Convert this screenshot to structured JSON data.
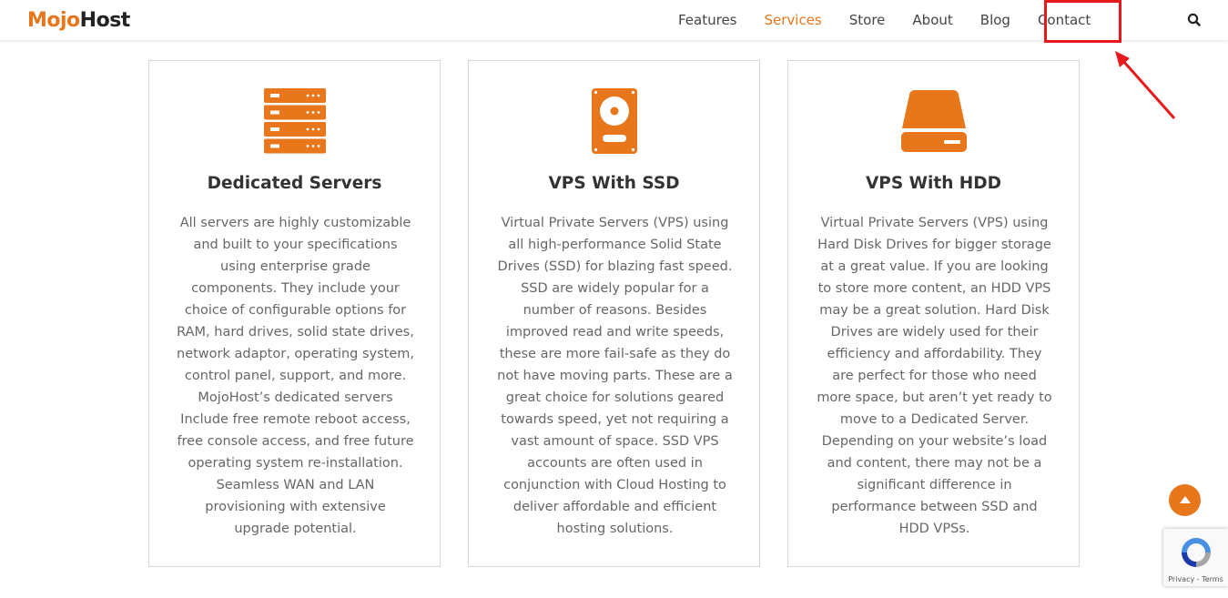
{
  "brand": {
    "logo_part1": "Mojo",
    "logo_part2": "Host",
    "accent": "#e8761a"
  },
  "nav": {
    "items": [
      {
        "label": "Features",
        "active": false
      },
      {
        "label": "Services",
        "active": true
      },
      {
        "label": "Store",
        "active": false
      },
      {
        "label": "About",
        "active": false
      },
      {
        "label": "Blog",
        "active": false
      },
      {
        "label": "Contact",
        "active": false
      }
    ],
    "search_icon": "search-icon"
  },
  "annotation": {
    "highlight_color": "#e8191b",
    "target": "Contact"
  },
  "cards": [
    {
      "icon": "server-rack-icon",
      "title": "Dedicated Servers",
      "text": "All servers are highly customizable and built to your specifications using enterprise grade components. They include your choice of configurable options for RAM, hard drives, solid state drives, network adaptor, operating system, control panel, support, and more. MojoHost’s dedicated servers Include free remote reboot access, free console access, and free future operating system re-installation. Seamless WAN and LAN provisioning with extensive upgrade potential."
    },
    {
      "icon": "hard-disk-icon",
      "title": "VPS With SSD",
      "text": "Virtual Private Servers (VPS) using all high-performance Solid State Drives (SSD) for blazing fast speed. SSD are widely popular for a number of reasons. Besides improved read and write speeds, these are more fail-safe as they do not have moving parts. These are a great choice for solutions geared towards speed, yet not requiring a vast amount of space. SSD VPS accounts are often used in conjunction with Cloud Hosting to deliver affordable and efficient hosting solutions."
    },
    {
      "icon": "hdd-drive-icon",
      "title": "VPS With HDD",
      "text": "Virtual Private Servers (VPS) using Hard Disk Drives for bigger storage at a great value. If you are looking to store more content, an HDD VPS may be a great solution. Hard Disk Drives are widely used for their efficiency and affordability. They are perfect for those who need more space, but aren’t yet ready to move to a Dedicated Server. Depending on your website’s load and content, there may not be a significant difference in performance between SSD and HDD VPSs."
    }
  ],
  "recaptcha": {
    "links": "Privacy - Terms"
  }
}
